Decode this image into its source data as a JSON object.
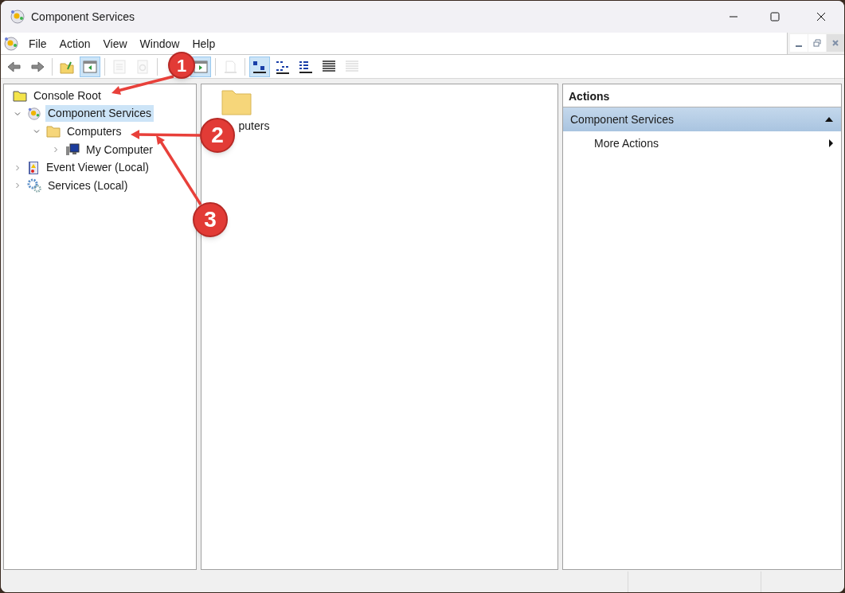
{
  "window": {
    "title": "Component Services"
  },
  "menu": [
    {
      "label": "File"
    },
    {
      "label": "Action"
    },
    {
      "label": "View"
    },
    {
      "label": "Window"
    },
    {
      "label": "Help"
    }
  ],
  "toolbar": [
    {
      "kind": "back",
      "disabled": false,
      "pressed": false
    },
    {
      "kind": "forward",
      "disabled": false,
      "pressed": false
    },
    {
      "kind": "sep"
    },
    {
      "kind": "up",
      "disabled": false,
      "pressed": false
    },
    {
      "kind": "tree",
      "disabled": false,
      "pressed": true
    },
    {
      "kind": "sep"
    },
    {
      "kind": "props",
      "disabled": true,
      "pressed": false
    },
    {
      "kind": "refresh",
      "disabled": true,
      "pressed": false
    },
    {
      "kind": "sep"
    },
    {
      "kind": "actionpane",
      "disabled": false,
      "pressed": true
    },
    {
      "kind": "sep"
    },
    {
      "kind": "newwin",
      "disabled": true,
      "pressed": false
    },
    {
      "kind": "sep"
    },
    {
      "kind": "largeicons",
      "disabled": false,
      "pressed": true
    },
    {
      "kind": "smallicons",
      "disabled": false,
      "pressed": false
    },
    {
      "kind": "list",
      "disabled": false,
      "pressed": false
    },
    {
      "kind": "details",
      "disabled": false,
      "pressed": false
    },
    {
      "kind": "export",
      "disabled": true,
      "pressed": false
    }
  ],
  "tree": [
    {
      "label": "Console Root",
      "kind": "folder-yellow",
      "selected": false,
      "children": [
        {
          "label": "Component Services",
          "kind": "component",
          "selected": true,
          "expanded": true,
          "children": [
            {
              "label": "Computers",
              "kind": "folder",
              "selected": false,
              "expanded": true,
              "children": [
                {
                  "label": "My Computer",
                  "kind": "computer",
                  "selected": false,
                  "expanded": false
                }
              ]
            }
          ]
        },
        {
          "label": "Event Viewer (Local)",
          "kind": "log",
          "selected": false,
          "expanded": false
        },
        {
          "label": "Services (Local)",
          "kind": "gear",
          "selected": false,
          "expanded": false
        }
      ]
    }
  ],
  "content": {
    "items": [
      {
        "label": "puters"
      }
    ]
  },
  "actions": {
    "title": "Actions",
    "sections": [
      {
        "title": "Component Services",
        "expanded": true,
        "items": [
          {
            "label": "More Actions",
            "submenu": true
          }
        ]
      }
    ]
  },
  "annotations": [
    {
      "label": "1"
    },
    {
      "label": "2"
    },
    {
      "label": "3"
    }
  ]
}
